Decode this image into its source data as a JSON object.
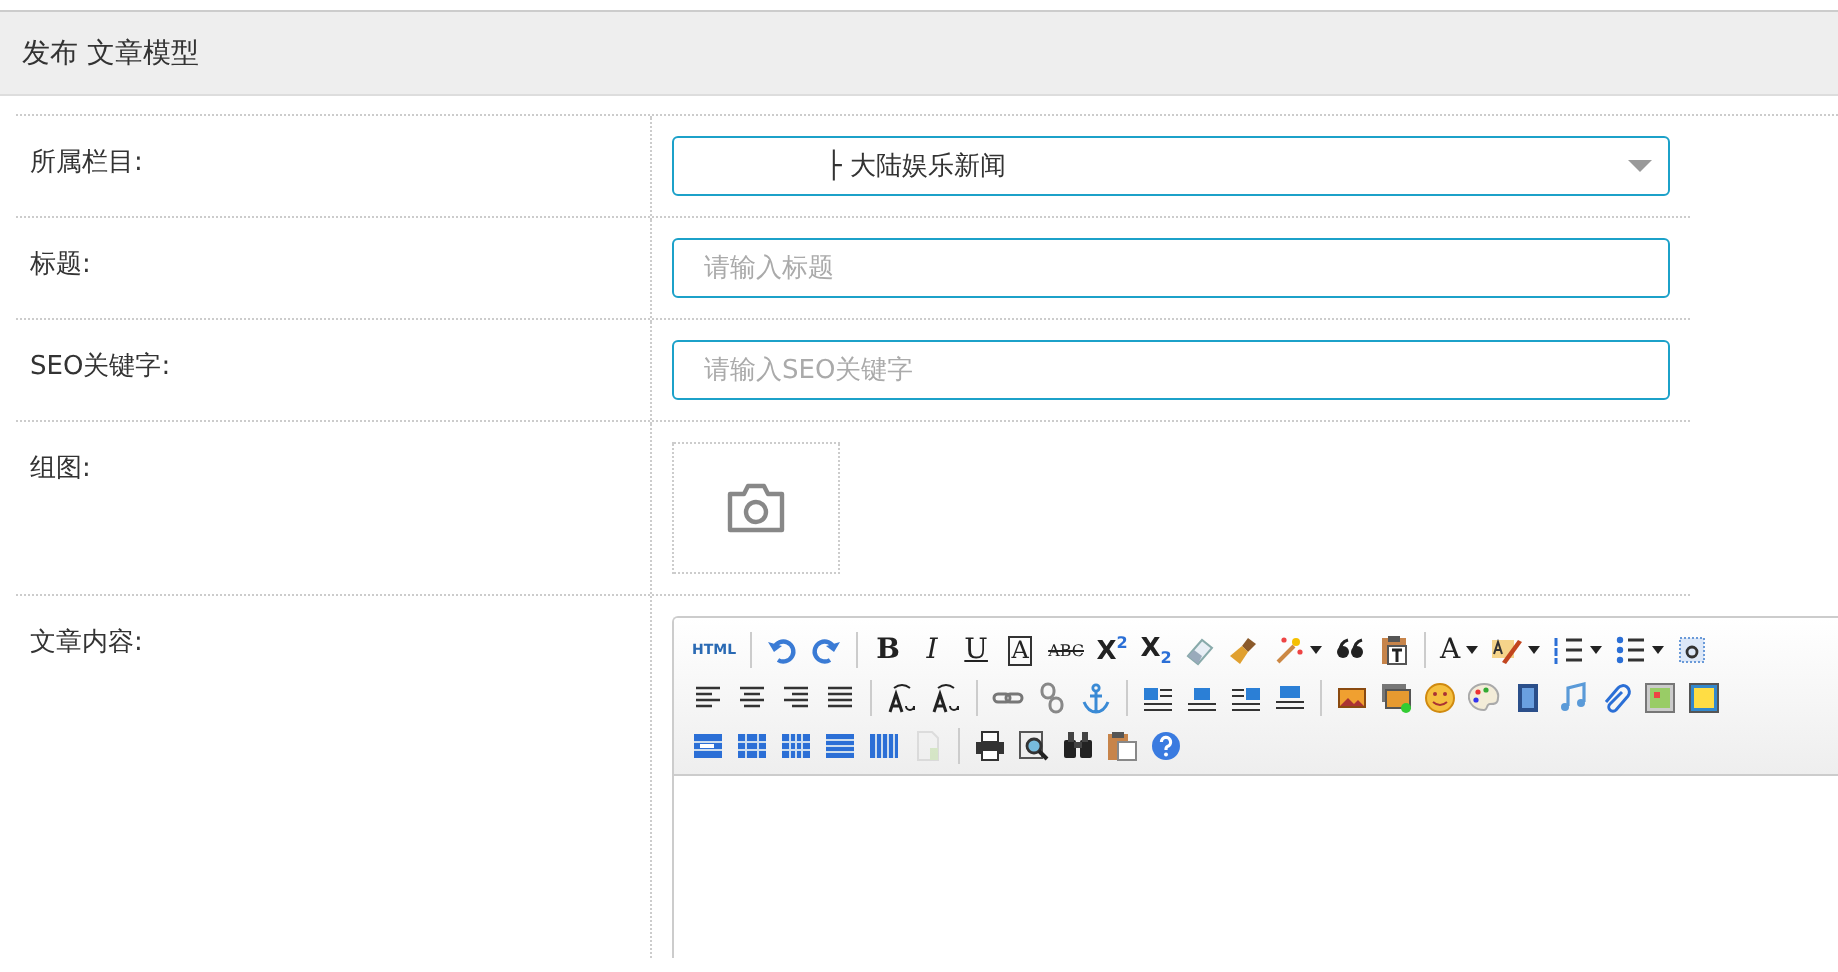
{
  "header": {
    "title": "发布 文章模型"
  },
  "fields": [
    {
      "kind": "select",
      "label": "所属栏目:",
      "value": "├ 大陆娱乐新闻"
    },
    {
      "kind": "text",
      "label": "标题:",
      "placeholder": "请输入标题"
    },
    {
      "kind": "text",
      "label": "SEO关键字:",
      "placeholder": "请输入SEO关键字"
    },
    {
      "kind": "images",
      "label": "组图:"
    },
    {
      "kind": "editor",
      "label": "文章内容:"
    }
  ],
  "toolbar": [
    [
      [
        {
          "kind": "text",
          "label": "HTML",
          "dropdown": false,
          "disabled": false
        }
      ],
      [
        {
          "kind": "icon",
          "dropdown": false,
          "disabled": false
        },
        {
          "kind": "icon",
          "dropdown": false,
          "disabled": false
        }
      ],
      [
        {
          "kind": "text",
          "label": "B",
          "dropdown": false,
          "disabled": false
        },
        {
          "kind": "text",
          "label": "I",
          "dropdown": false,
          "disabled": false
        },
        {
          "kind": "text",
          "label": "U",
          "dropdown": false,
          "disabled": false
        },
        {
          "kind": "text",
          "label": "A",
          "dropdown": false,
          "disabled": false
        },
        {
          "kind": "text",
          "label": "ABC",
          "dropdown": false,
          "disabled": false
        },
        {
          "kind": "text",
          "label": "X$^{2}$",
          "dropdown": false,
          "disabled": false
        },
        {
          "kind": "text",
          "label": "X$_{2}$",
          "dropdown": false,
          "disabled": false
        },
        {
          "kind": "icon",
          "dropdown": false,
          "disabled": false
        },
        {
          "kind": "icon",
          "dropdown": false,
          "disabled": false
        },
        {
          "kind": "icon",
          "dropdown": true,
          "disabled": false
        },
        {
          "kind": "icon",
          "dropdown": false,
          "disabled": false
        },
        {
          "kind": "icon",
          "dropdown": false,
          "disabled": false
        }
      ],
      [
        {
          "kind": "text",
          "label": "A",
          "dropdown": true,
          "disabled": false
        },
        {
          "kind": "icon",
          "dropdown": true,
          "disabled": false
        },
        {
          "kind": "icon",
          "dropdown": true,
          "disabled": false
        },
        {
          "kind": "icon",
          "dropdown": true,
          "disabled": false
        },
        {
          "kind": "icon",
          "dropdown": false,
          "disabled": false
        }
      ]
    ],
    [
      [
        {
          "kind": "icon",
          "dropdown": false,
          "disabled": false
        },
        {
          "kind": "icon",
          "dropdown": false,
          "disabled": false
        },
        {
          "kind": "icon",
          "dropdown": false,
          "disabled": false
        },
        {
          "kind": "icon",
          "dropdown": false,
          "disabled": false
        }
      ],
      [
        {
          "kind": "icon",
          "dropdown": false,
          "disabled": false
        },
        {
          "kind": "icon",
          "dropdown": false,
          "disabled": false
        }
      ],
      [
        {
          "kind": "icon",
          "dropdown": false,
          "disabled": false
        },
        {
          "kind": "icon",
          "dropdown": false,
          "disabled": false
        },
        {
          "kind": "icon",
          "dropdown": false,
          "disabled": false
        }
      ],
      [
        {
          "kind": "icon",
          "dropdown": false,
          "disabled": false
        },
        {
          "kind": "icon",
          "dropdown": false,
          "disabled": false
        },
        {
          "kind": "icon",
          "dropdown": false,
          "disabled": false
        },
        {
          "kind": "icon",
          "dropdown": false,
          "disabled": false
        }
      ],
      [
        {
          "kind": "icon",
          "dropdown": false,
          "disabled": false
        },
        {
          "kind": "icon",
          "dropdown": false,
          "disabled": false
        },
        {
          "kind": "icon",
          "dropdown": false,
          "disabled": false
        },
        {
          "kind": "icon",
          "dropdown": false,
          "disabled": false
        },
        {
          "kind": "icon",
          "dropdown": false,
          "disabled": false
        },
        {
          "kind": "icon",
          "dropdown": false,
          "disabled": false
        },
        {
          "kind": "icon",
          "dropdown": false,
          "disabled": false
        },
        {
          "kind": "icon",
          "dropdown": false,
          "disabled": false
        },
        {
          "kind": "icon",
          "dropdown": false,
          "disabled": false
        }
      ]
    ],
    [
      [
        {
          "kind": "icon",
          "dropdown": false,
          "disabled": false
        },
        {
          "kind": "icon",
          "dropdown": false,
          "disabled": false
        },
        {
          "kind": "icon",
          "dropdown": false,
          "disabled": false
        },
        {
          "kind": "icon",
          "dropdown": false,
          "disabled": false
        },
        {
          "kind": "icon",
          "dropdown": false,
          "disabled": false
        },
        {
          "kind": "icon",
          "dropdown": false,
          "disabled": true
        }
      ],
      [
        {
          "kind": "icon",
          "dropdown": false,
          "disabled": false
        },
        {
          "kind": "icon",
          "dropdown": false,
          "disabled": false
        },
        {
          "kind": "icon",
          "dropdown": false,
          "disabled": false
        },
        {
          "kind": "icon",
          "dropdown": false,
          "disabled": false
        },
        {
          "kind": "icon",
          "dropdown": false,
          "disabled": false
        }
      ]
    ]
  ]
}
